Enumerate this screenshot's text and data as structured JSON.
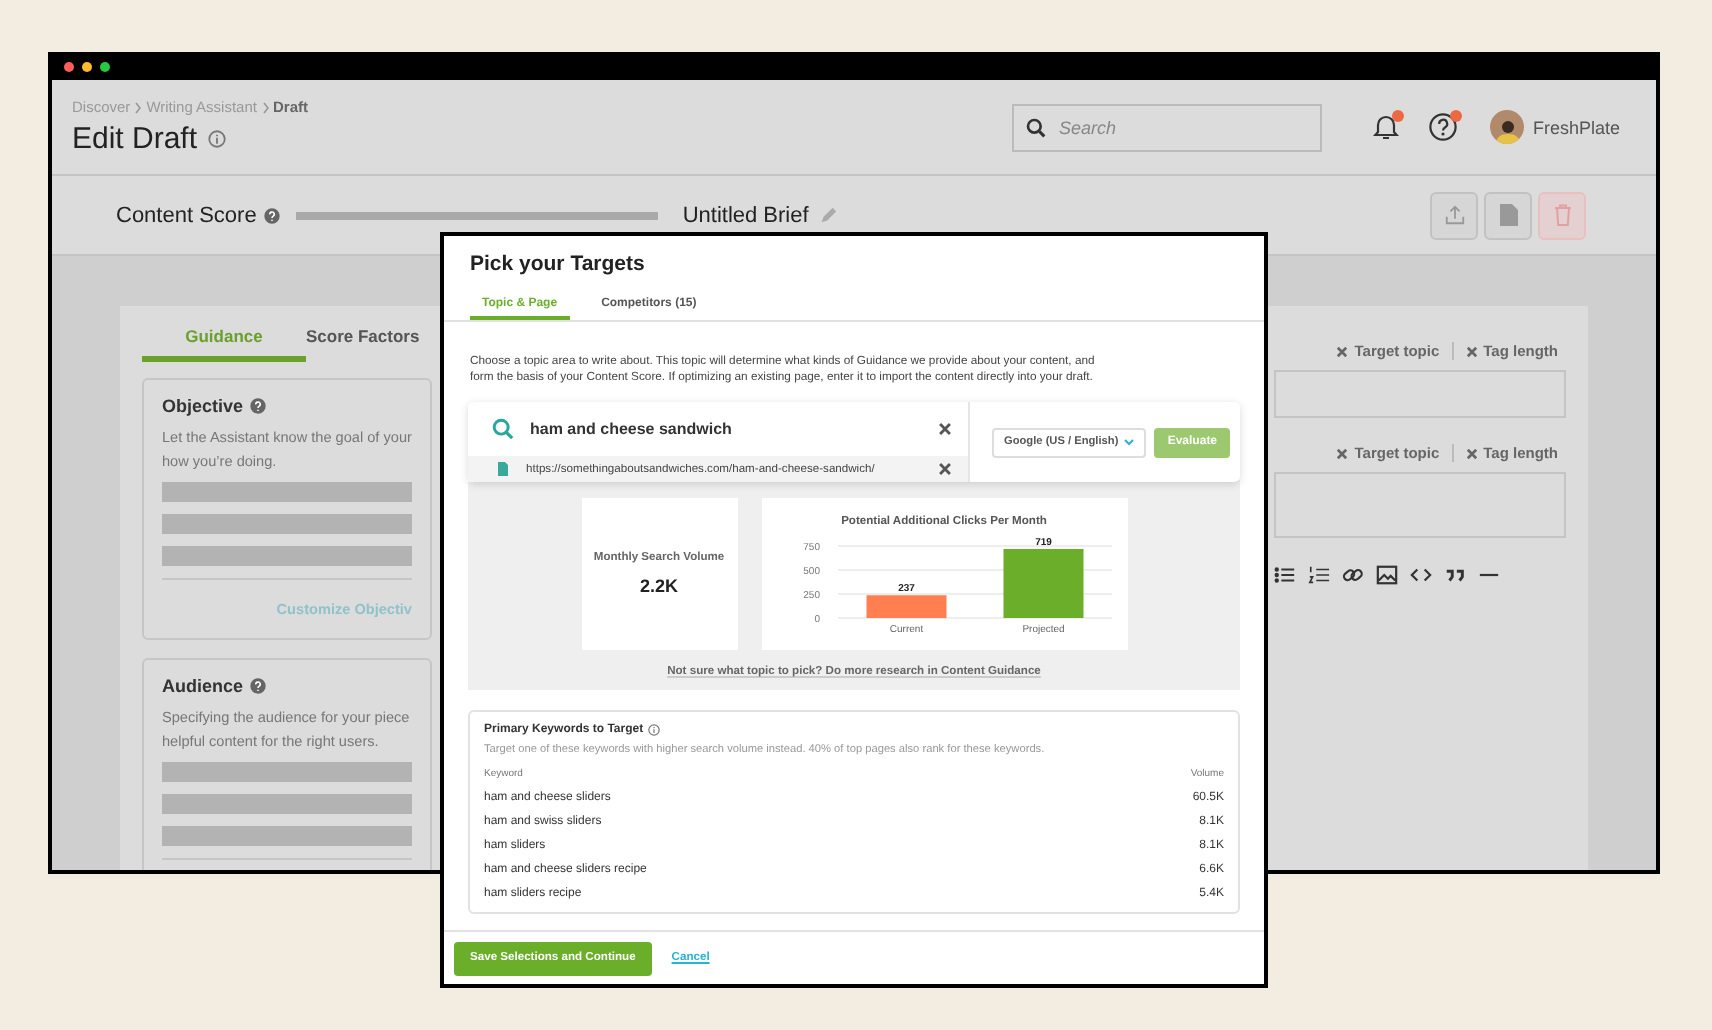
{
  "breadcrumb": [
    {
      "label": "Discover",
      "current": false
    },
    {
      "label": "Writing Assistant",
      "current": false
    },
    {
      "label": "Draft",
      "current": true
    }
  ],
  "page_title": "Edit Draft",
  "search": {
    "placeholder": "Search"
  },
  "notifications": {
    "unread": true
  },
  "help": {
    "unread": true
  },
  "user": {
    "name": "FreshPlate"
  },
  "score": {
    "label": "Content Score"
  },
  "brief": {
    "title": "Untitled Brief"
  },
  "guidance_tabs": [
    {
      "label": "Guidance",
      "selected": true
    },
    {
      "label": "Score Factors",
      "selected": false
    }
  ],
  "sections": [
    {
      "title": "Objective",
      "lines": [
        "Let the Assistant know the goal of your",
        "how you’re doing."
      ],
      "link": "Customize Objectiv"
    },
    {
      "title": "Audience",
      "lines": [
        "Specifying the audience for your piece",
        "helpful content for the right users."
      ]
    }
  ],
  "tag_rows": [
    {
      "tags": [
        "Target topic",
        "Tag length"
      ]
    },
    {
      "tags": [
        "Target topic",
        "Tag length"
      ]
    }
  ],
  "modal": {
    "title": "Pick your Targets",
    "tabs": [
      {
        "label": "Topic & Page",
        "selected": true
      },
      {
        "label": "Competitors (15)",
        "selected": false
      }
    ],
    "description": "Choose a topic area to write about. This topic will determine what kinds of Guidance we provide about your content, and form the basis of your Content Score. If optimizing an existing page, enter it to import the content directly into your draft.",
    "topic": {
      "value": "ham and cheese sandwich"
    },
    "url": {
      "value": "https://somethingaboutsandwiches.com/ham-and-cheese-sandwich/"
    },
    "engine": {
      "value": "Google (US / English)"
    },
    "evaluate": {
      "label": "Evaluate",
      "disabled": true
    },
    "volume": {
      "label": "Monthly Search Volume",
      "value": "2.2K"
    },
    "chart_data": {
      "type": "bar",
      "title": "Potential Additional Clicks Per Month",
      "categories": [
        "Current",
        "Projected"
      ],
      "values": [
        237,
        719
      ],
      "colors": [
        "#ff7f50",
        "#6aae2a"
      ],
      "ylim": [
        0,
        750
      ],
      "yticks": [
        0,
        250,
        500,
        750
      ],
      "data_labels": true
    },
    "research_link": "Not sure what topic to pick? Do more research in Content Guidance",
    "keywords": {
      "title": "Primary Keywords to Target",
      "subtitle": "Target one of these keywords with higher search volume instead. 40% of top pages also rank for these keywords.",
      "columns": [
        "Keyword",
        "Volume"
      ],
      "rows": [
        [
          "ham and cheese sliders",
          "60.5K"
        ],
        [
          "ham and swiss sliders",
          "8.1K"
        ],
        [
          "ham sliders",
          "8.1K"
        ],
        [
          "ham and cheese sliders recipe",
          "6.6K"
        ],
        [
          "ham sliders recipe",
          "5.4K"
        ]
      ]
    },
    "save": "Save Selections and Continue",
    "cancel": "Cancel"
  }
}
